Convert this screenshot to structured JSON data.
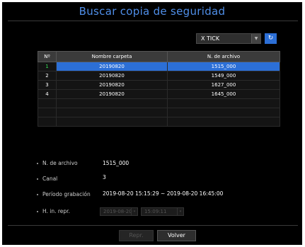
{
  "dialog": {
    "title": "Buscar copia de seguridad"
  },
  "device": {
    "selected": "X TICK",
    "refresh_icon": "refresh-icon"
  },
  "table": {
    "headers": [
      "Nº",
      "Nombre carpeta",
      "N. de archivo"
    ],
    "rows": [
      {
        "idx": "1",
        "folder": "20190820",
        "file": "1515_000"
      },
      {
        "idx": "2",
        "folder": "20190820",
        "file": "1549_000"
      },
      {
        "idx": "3",
        "folder": "20190820",
        "file": "1627_000"
      },
      {
        "idx": "4",
        "folder": "20190820",
        "file": "1645_000"
      }
    ],
    "selected_color": "#2c6fd6",
    "selected_index_color": "#33dd55"
  },
  "info": {
    "file_label": "N. de archivo",
    "file_value": "1515_000",
    "channel_label": "Canal",
    "channel_value": "3",
    "period_label": "Período grabación",
    "period_value": "2019-08-20 15:15:29 ~ 2019-08-20 16:45:00",
    "start_label": "H. in. repr.",
    "start_date": "2019-08-20",
    "start_time": "15:09:11"
  },
  "buttons": {
    "play": "Repr.",
    "back": "Volver"
  },
  "colors": {
    "accent": "#4f8ee8",
    "background": "#000000"
  }
}
